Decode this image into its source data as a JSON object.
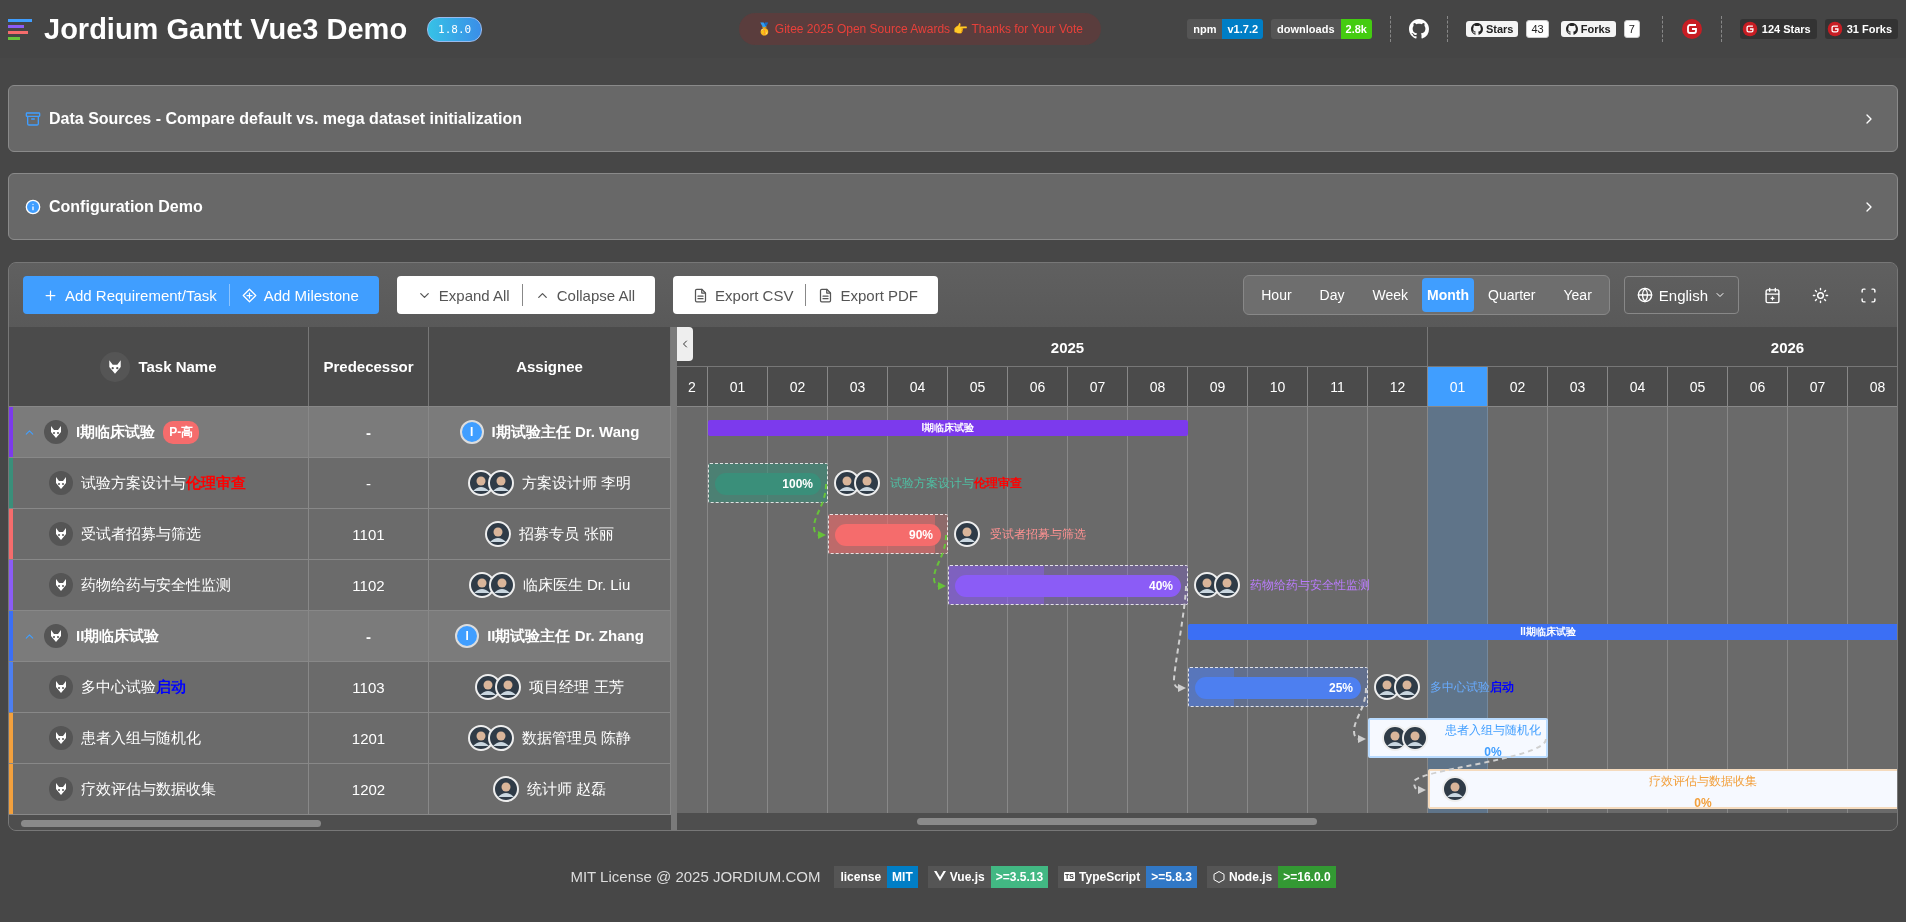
{
  "header": {
    "title": "Jordium Gantt Vue3 Demo",
    "version": "1.8.0",
    "award": "🥇 Gitee 2025 Open Source Awards 👉 Thanks for Your Vote",
    "badges": [
      {
        "label": "npm",
        "value": "v1.7.2",
        "color": "#007ec6"
      },
      {
        "label": "downloads",
        "value": "2.8k",
        "color": "#44cc11"
      }
    ],
    "github": [
      {
        "label": "Stars",
        "count": "43"
      },
      {
        "label": "Forks",
        "count": "7"
      }
    ],
    "gitee": [
      {
        "label": "124 Stars"
      },
      {
        "label": "31 Forks"
      }
    ]
  },
  "panels": [
    {
      "title": "Data Sources - Compare default vs. mega dataset initialization",
      "kind": "database",
      "expanded": false
    },
    {
      "title": "Configuration Demo",
      "kind": "info",
      "expanded": false
    }
  ],
  "toolbar": {
    "groups": [
      {
        "kind": "primary",
        "buttons": [
          {
            "label": "Add Requirement/Task"
          },
          {
            "label": "Add Milestone"
          }
        ]
      },
      {
        "kind": "plain",
        "buttons": [
          {
            "label": "Expand All"
          },
          {
            "label": "Collapse All"
          }
        ]
      },
      {
        "kind": "plain",
        "buttons": [
          {
            "label": "Export CSV"
          },
          {
            "label": "Export PDF"
          }
        ]
      }
    ],
    "views": [
      {
        "label": "Hour",
        "selected": false
      },
      {
        "label": "Day",
        "selected": false
      },
      {
        "label": "Week",
        "selected": false
      },
      {
        "label": "Month",
        "selected": true
      },
      {
        "label": "Quarter",
        "selected": false
      },
      {
        "label": "Year",
        "selected": false
      }
    ],
    "language": "English"
  },
  "table": {
    "columns": [
      "Task Name",
      "Predecessor",
      "Assignee"
    ],
    "rows": [
      {
        "kind": "group",
        "name": "I期临床试验",
        "tag": "P-高",
        "expanded": true,
        "predecessor": "-",
        "assignee": "I期试验主任 Dr. Wang",
        "initial": "I",
        "color": "#7c3aed",
        "bar": {
          "kind": "summary",
          "label": "I期临床试验"
        }
      },
      {
        "kind": "task",
        "name": "试验方案设计与",
        "highlight": {
          "text": "伦理审查",
          "color": "#ff0000"
        },
        "predecessor": "-",
        "assignee": "方案设计师 李明",
        "color": "#3a8f7a",
        "bar": {
          "kind": "pill",
          "label": "试验方案设计与",
          "highlight": {
            "text": "伦理审查",
            "color": "#ff0000"
          },
          "progress": "100%",
          "level": 1
        }
      },
      {
        "kind": "task",
        "name": "受试者招募与筛选",
        "predecessor": "1101",
        "assignee": "招募专员 张丽",
        "color": "#f56c6c",
        "bar": {
          "kind": "pill",
          "label": "受试者招募与筛选",
          "progress": "90%",
          "level": 0.9
        }
      },
      {
        "kind": "task",
        "name": "药物给药与安全性监测",
        "predecessor": "1102",
        "assignee": "临床医生 Dr. Liu",
        "color": "#8b5cf6",
        "bar": {
          "kind": "pill",
          "label": "药物给药与安全性监测",
          "progress": "40%",
          "level": 0.4
        }
      },
      {
        "kind": "group",
        "name": "II期临床试验",
        "expanded": true,
        "predecessor": "-",
        "assignee": "II期试验主任 Dr. Zhang",
        "initial": "I",
        "color": "#3b6ff5",
        "bar": {
          "kind": "summary",
          "label": "II期临床试验"
        }
      },
      {
        "kind": "task",
        "name": "多中心试验",
        "highlight": {
          "text": "启动",
          "color": "#0000ff"
        },
        "predecessor": "1103",
        "assignee": "项目经理 王芳",
        "color": "#4d7ff0",
        "bar": {
          "kind": "pill",
          "label": "多中心试验",
          "highlight": {
            "text": "启动",
            "color": "#0000ff"
          },
          "progress": "25%",
          "level": 0.25
        }
      },
      {
        "kind": "task",
        "name": "患者入组与随机化",
        "predecessor": "1201",
        "assignee": "数据管理员 陈静",
        "color": "#f2a03d",
        "bar": {
          "kind": "card",
          "label": "患者入组与随机化",
          "progress": "0%",
          "level": 0,
          "color": "#409eff"
        }
      },
      {
        "kind": "task",
        "name": "疗效评估与数据收集",
        "predecessor": "1202",
        "assignee": "统计师 赵磊",
        "color": "#f2a03d",
        "bar": {
          "kind": "card",
          "label": "疗效评估与数据收集",
          "progress": "0%",
          "level": 0,
          "color": "#f2a03d"
        }
      }
    ]
  },
  "timeline": {
    "years": [
      {
        "label": "2025"
      },
      {
        "label": "2026"
      }
    ],
    "months": [
      {
        "label": "2",
        "current": false
      },
      {
        "label": "01",
        "current": false
      },
      {
        "label": "02",
        "current": false
      },
      {
        "label": "03",
        "current": false
      },
      {
        "label": "04",
        "current": false
      },
      {
        "label": "05",
        "current": false
      },
      {
        "label": "06",
        "current": false
      },
      {
        "label": "07",
        "current": false
      },
      {
        "label": "08",
        "current": false
      },
      {
        "label": "09",
        "current": false
      },
      {
        "label": "10",
        "current": false
      },
      {
        "label": "11",
        "current": false
      },
      {
        "label": "12",
        "current": false
      },
      {
        "label": "01",
        "current": true
      },
      {
        "label": "02",
        "current": false
      },
      {
        "label": "03",
        "current": false
      },
      {
        "label": "04",
        "current": false
      },
      {
        "label": "05",
        "current": false
      },
      {
        "label": "06",
        "current": false
      },
      {
        "label": "07",
        "current": false
      },
      {
        "label": "08",
        "current": false
      }
    ]
  },
  "footer": {
    "text": "MIT License @ 2025 JORDIUM.COM",
    "badges": [
      {
        "label": "license",
        "value": "MIT",
        "color": "#007ec6"
      },
      {
        "label": "Vue.js",
        "value": ">=3.5.13",
        "color": "#42b883"
      },
      {
        "label": "TypeScript",
        "value": ">=5.8.3",
        "color": "#3178c6",
        "logo_text": "TS"
      },
      {
        "label": "Node.js",
        "value": ">=16.0.0",
        "color": "#339933"
      }
    ]
  }
}
